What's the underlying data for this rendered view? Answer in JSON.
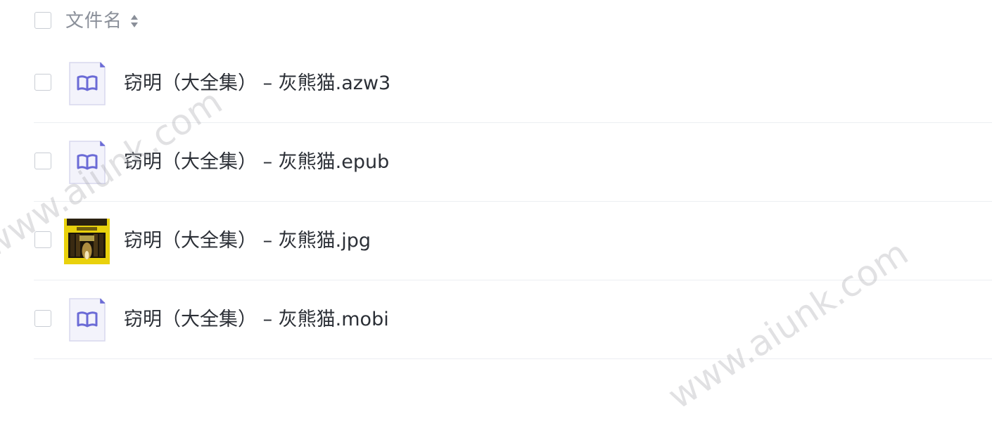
{
  "header": {
    "column_label": "文件名",
    "sort_icon": "sort-icon"
  },
  "files": [
    {
      "name": "窃明（大全集） – 灰熊猫.azw3",
      "icon": "ebook-icon"
    },
    {
      "name": "窃明（大全集） – 灰熊猫.epub",
      "icon": "ebook-icon"
    },
    {
      "name": "窃明（大全集） – 灰熊猫.jpg",
      "icon": "image-thumbnail"
    },
    {
      "name": "窃明（大全集） – 灰熊猫.mobi",
      "icon": "ebook-icon"
    }
  ],
  "watermark": {
    "text_1": "www.aiunk.com",
    "text_2": "www.aiunk.com"
  },
  "colors": {
    "ebook_icon": "#6b6bd6",
    "ebook_icon_bg": "#f3f3fb",
    "thumbnail_bg": "#e9d10c",
    "text": "#2b2f36",
    "header_text": "#8a8f99"
  }
}
